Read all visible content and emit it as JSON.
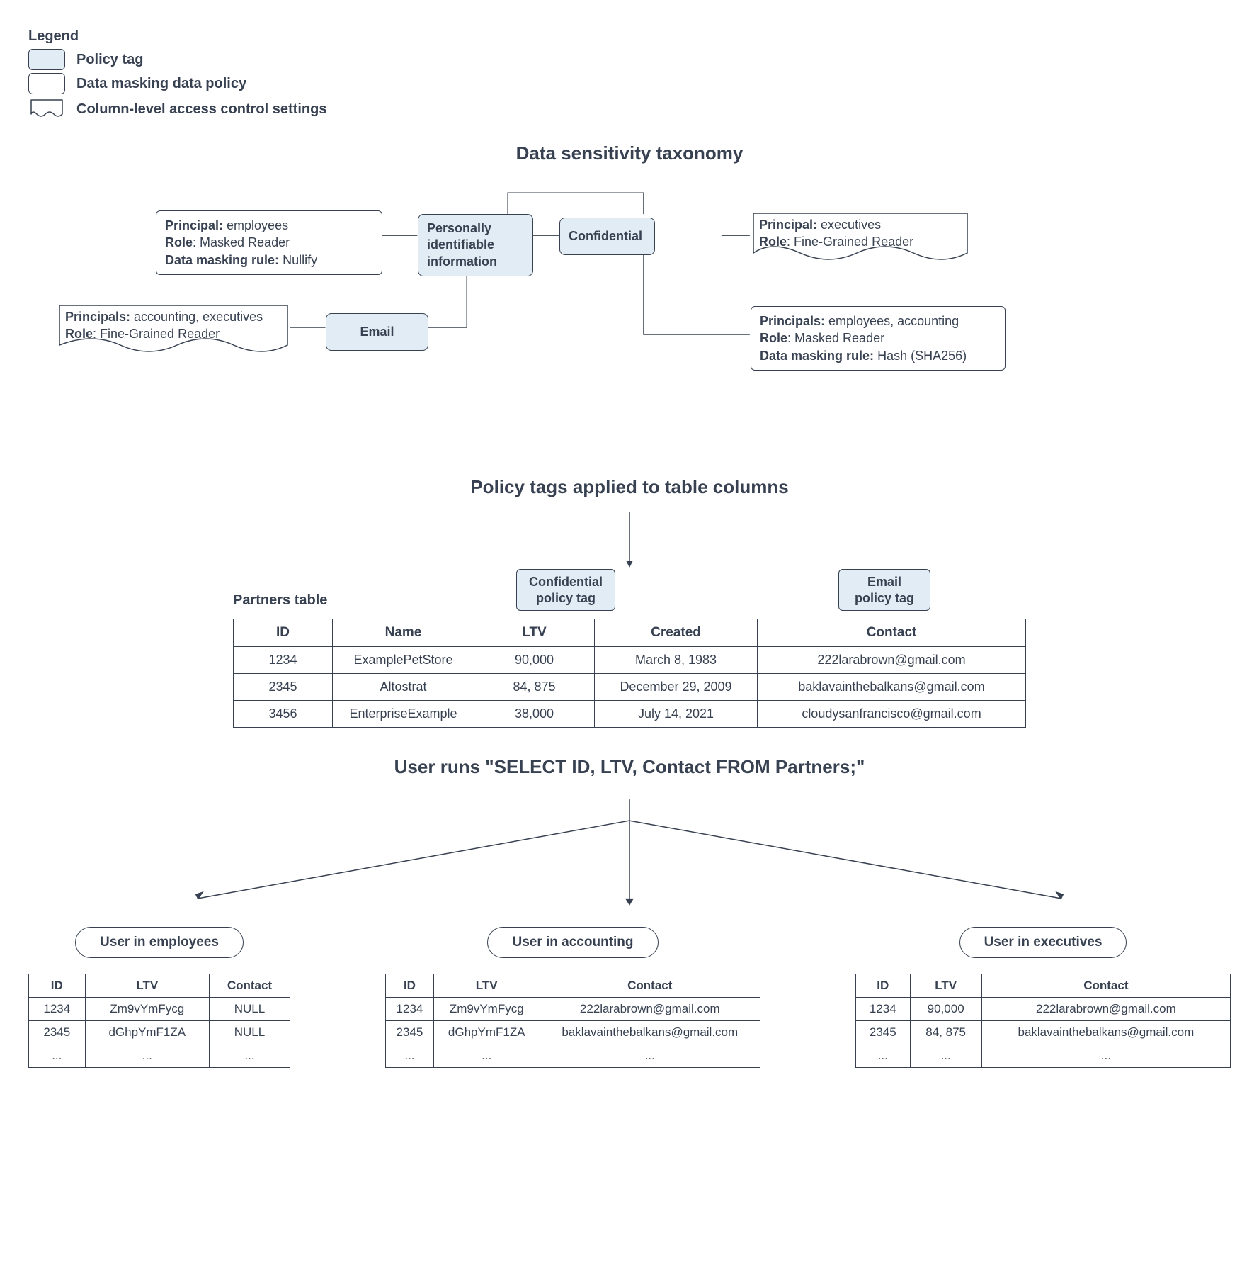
{
  "legend": {
    "title": "Legend",
    "policy_tag": "Policy tag",
    "data_masking": "Data masking data policy",
    "acl": "Column-level access control settings"
  },
  "sections": {
    "taxonomy": "Data sensitivity taxonomy",
    "applied": "Policy tags applied to table columns",
    "query": "User runs \"SELECT ID, LTV, Contact FROM Partners;\""
  },
  "tags": {
    "pii": "Personally identifiable information",
    "confidential": "Confidential",
    "email": "Email",
    "confidential_small": "Confidential policy tag",
    "email_small": "Email policy tag"
  },
  "boxes": {
    "pii_masking": {
      "principal_label": "Principal:",
      "principal": " employees",
      "role_label": "Role",
      "role": ": Masked Reader",
      "rule_label": "Data masking rule:",
      "rule": " Nullify"
    },
    "confidential_acl": {
      "principal_label": "Principal:",
      "principal": " executives",
      "role_label": "Role",
      "role": ": Fine-Grained Reader"
    },
    "email_acl": {
      "principal_label": "Principals:",
      "principal": " accounting, executives",
      "role_label": "Role",
      "role": ": Fine-Grained Reader"
    },
    "confidential_masking": {
      "principal_label": "Principals:",
      "principal": " employees, accounting",
      "role_label": "Role",
      "role": ": Masked Reader",
      "rule_label": "Data masking rule:",
      "rule": " Hash (SHA256)"
    }
  },
  "partners_table": {
    "label": "Partners table",
    "headers": {
      "id": "ID",
      "name": "Name",
      "ltv": "LTV",
      "created": "Created",
      "contact": "Contact"
    },
    "rows": [
      {
        "id": "1234",
        "name": "ExamplePetStore",
        "ltv": "90,000",
        "created": "March 8, 1983",
        "contact": "222larabrown@gmail.com"
      },
      {
        "id": "2345",
        "name": "Altostrat",
        "ltv": "84, 875",
        "created": "December 29, 2009",
        "contact": "baklavainthebalkans@gmail.com"
      },
      {
        "id": "3456",
        "name": "EnterpriseExample",
        "ltv": "38,000",
        "created": "July 14, 2021",
        "contact": "cloudysanfrancisco@gmail.com"
      }
    ]
  },
  "results": {
    "employees": {
      "label": "User in employees",
      "headers": {
        "id": "ID",
        "ltv": "LTV",
        "contact": "Contact"
      },
      "rows": [
        {
          "id": "1234",
          "ltv": "Zm9vYmFycg",
          "contact": "NULL"
        },
        {
          "id": "2345",
          "ltv": "dGhpYmF1ZA",
          "contact": "NULL"
        },
        {
          "id": "...",
          "ltv": "...",
          "contact": "..."
        }
      ]
    },
    "accounting": {
      "label": "User in accounting",
      "headers": {
        "id": "ID",
        "ltv": "LTV",
        "contact": "Contact"
      },
      "rows": [
        {
          "id": "1234",
          "ltv": "Zm9vYmFycg",
          "contact": "222larabrown@gmail.com"
        },
        {
          "id": "2345",
          "ltv": "dGhpYmF1ZA",
          "contact": "baklavainthebalkans@gmail.com"
        },
        {
          "id": "...",
          "ltv": "...",
          "contact": "..."
        }
      ]
    },
    "executives": {
      "label": "User in executives",
      "headers": {
        "id": "ID",
        "ltv": "LTV",
        "contact": "Contact"
      },
      "rows": [
        {
          "id": "1234",
          "ltv": "90,000",
          "contact": "222larabrown@gmail.com"
        },
        {
          "id": "2345",
          "ltv": "84, 875",
          "contact": "baklavainthebalkans@gmail.com"
        },
        {
          "id": "...",
          "ltv": "...",
          "contact": "..."
        }
      ]
    }
  }
}
